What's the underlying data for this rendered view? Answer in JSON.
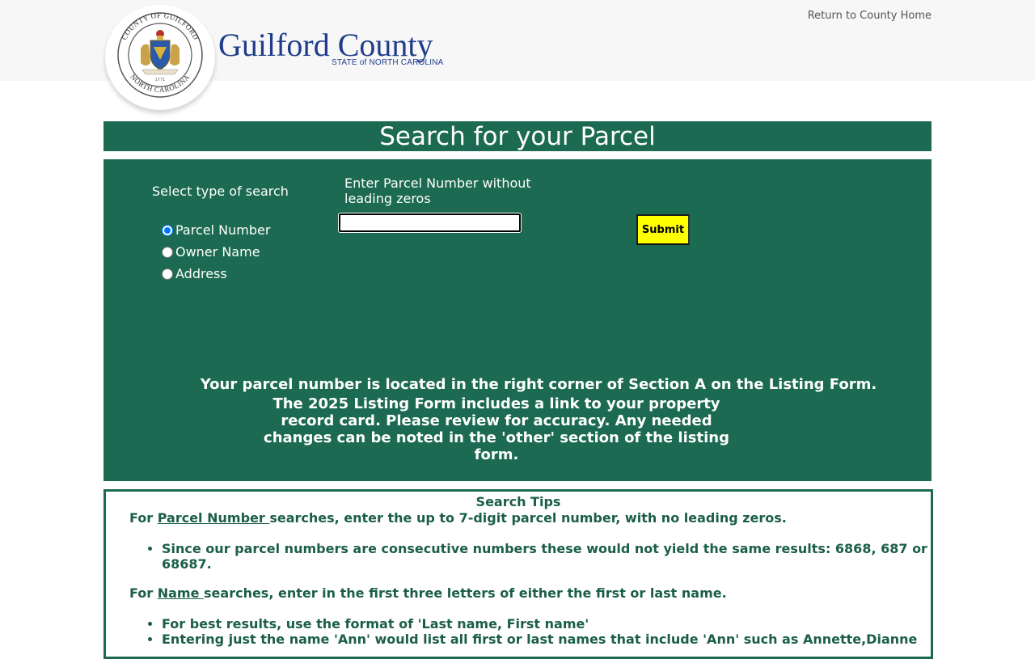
{
  "header": {
    "seal_text_top": "COUNTY OF GUILFORD",
    "seal_text_bottom": "NORTH CAROLINA",
    "seal_year": "1771",
    "brand_name": "Guilford County",
    "brand_sub": "STATE of NORTH CAROLINA",
    "home_link": "Return to County Home"
  },
  "page_title": "Search for your Parcel",
  "search": {
    "type_label": "Select type of search",
    "options": [
      {
        "label": "Parcel Number",
        "checked": true
      },
      {
        "label": "Owner Name",
        "checked": false
      },
      {
        "label": "Address",
        "checked": false
      }
    ],
    "input_label": "Enter Parcel Number without leading zeros",
    "input_value": "",
    "submit_label": "Submit",
    "note_line": "Your parcel number is located in the right corner of Section A on the Listing Form.",
    "note_para": "The 2025 Listing Form includes a link to your property record card. Please review for accuracy. Any needed changes can be noted in the 'other' section of the listing form."
  },
  "tips": {
    "title": "Search Tips",
    "parcel": {
      "prefix": "For ",
      "link": "Parcel Number ",
      "suffix": "searches, enter the up to 7-digit parcel number, with no leading zeros.",
      "bullets": [
        "Since our parcel numbers are consecutive numbers these would not yield the same results: 6868, 687 or 68687."
      ]
    },
    "name": {
      "prefix": "For ",
      "link": "Name ",
      "suffix": "searches, enter in the first three letters of either the first or last name.",
      "bullets": [
        "For best results, use the format of 'Last name, First name'",
        "Entering just the name 'Ann' would list all first or last names that include 'Ann' such as Annette,Dianne"
      ]
    }
  },
  "colors": {
    "green": "#1b6a51",
    "submit": "#ffff00",
    "brand_blue": "#1f3d8a"
  }
}
